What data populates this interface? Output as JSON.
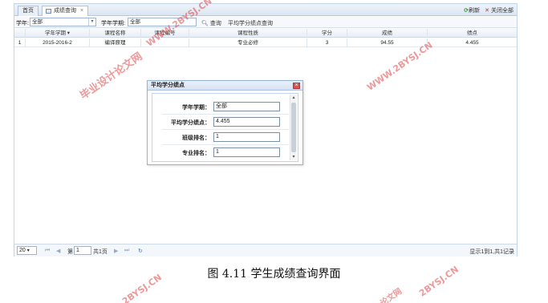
{
  "tabs": {
    "home": "首页",
    "active": "成绩查询",
    "active_close": "×",
    "refresh": "刷新",
    "close_all": "关闭全部"
  },
  "search": {
    "year_label": "学年:",
    "year_value": "全部",
    "term_label": "学年学期:",
    "term_value": "全部",
    "query_btn": "查询",
    "gpa_btn": "平均学分绩点查询"
  },
  "grid": {
    "columns": [
      "",
      "学年学期",
      "课程名称",
      "课程编号",
      "课程性质",
      "学分",
      "成绩",
      "绩点"
    ],
    "rows": [
      [
        "1",
        "2015-2016-2",
        "编译原理",
        "",
        "专业必修",
        "3",
        "94.55",
        "4.455"
      ]
    ]
  },
  "pager": {
    "page_size": "20",
    "page_prefix": "第",
    "page_value": "1",
    "page_total": "共1页",
    "summary": "显示1到1,共1记录"
  },
  "dialog": {
    "title": "平均学分绩点",
    "close": "×",
    "fields": [
      {
        "label": "学年学期：",
        "value": "全部"
      },
      {
        "label": "平均学分绩点：",
        "value": "4.455"
      },
      {
        "label": "班级排名：",
        "value": "1"
      },
      {
        "label": "专业排名：",
        "value": "1"
      }
    ]
  },
  "caption": "图 4.11  学生成绩查询界面",
  "watermarks": [
    "毕业设计论文网",
    "WWW.2BYSJ.CN",
    "WWW.2BYSJ.CN",
    "2BYSJ.CN",
    "2BYSJ.CN",
    "论文网"
  ]
}
